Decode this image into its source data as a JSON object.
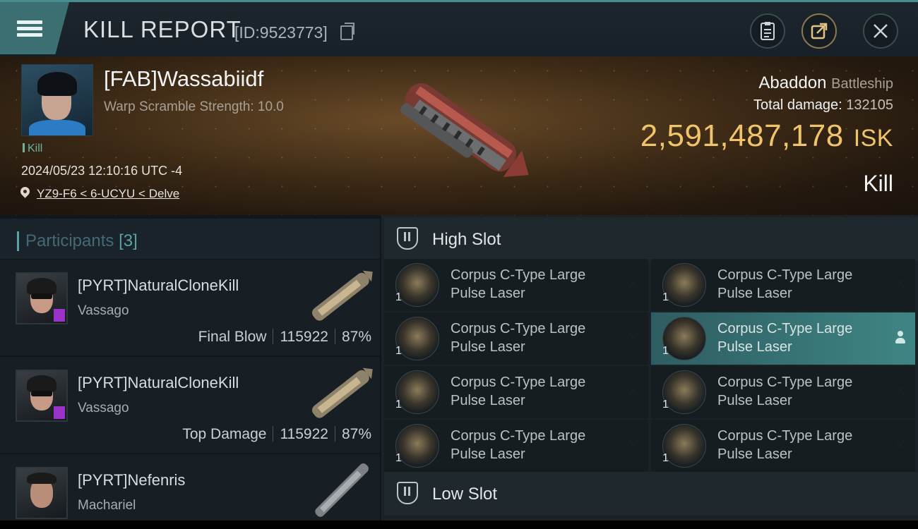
{
  "header": {
    "title": "KILL REPORT",
    "report_id": "[ID:9523773]"
  },
  "victim": {
    "name": "[FAB]Wassabiidf",
    "subtitle": "Warp Scramble Strength: 10.0",
    "kill_tag": "Kill",
    "datetime": "2024/05/23 12:10:16 UTC -4",
    "location": "YZ9-F6 < 6-UCYU < Delve",
    "ship_name": "Abaddon",
    "ship_class": "Battleship",
    "total_damage_label": "Total damage:",
    "total_damage_value": "132105",
    "isk_value": "2,591,487,178",
    "isk_unit": "ISK",
    "result": "Kill"
  },
  "participants": {
    "title": "Participants",
    "count": "[3]",
    "rows": [
      {
        "name": "[PYRT]NaturalCloneKill",
        "ship": "Vassago",
        "role": "Final Blow",
        "damage": "115922",
        "percent": "87%"
      },
      {
        "name": "[PYRT]NaturalCloneKill",
        "ship": "Vassago",
        "role": "Top Damage",
        "damage": "115922",
        "percent": "87%"
      },
      {
        "name": "[PYRT]Nefenris",
        "ship": "Machariel",
        "role": "",
        "damage": "",
        "percent": ""
      }
    ]
  },
  "fitting": {
    "high_slot_label": "High Slot",
    "low_slot_label": "Low Slot",
    "items": [
      {
        "line1": "Corpus C-Type Large",
        "line2": "Pulse Laser",
        "qty": "1"
      },
      {
        "line1": "Corpus C-Type Large",
        "line2": "Pulse Laser",
        "qty": "1"
      },
      {
        "line1": "Corpus C-Type Large",
        "line2": "Pulse Laser",
        "qty": "1"
      },
      {
        "line1": "Corpus C-Type Large",
        "line2": "Pulse Laser",
        "qty": "1"
      },
      {
        "line1": "Corpus C-Type Large",
        "line2": "Pulse Laser",
        "qty": "1"
      },
      {
        "line1": "Corpus C-Type Large",
        "line2": "Pulse Laser",
        "qty": "1"
      },
      {
        "line1": "Corpus C-Type Large",
        "line2": "Pulse Laser",
        "qty": "1"
      },
      {
        "line1": "Corpus C-Type Large",
        "line2": "Pulse Laser",
        "qty": "1"
      }
    ]
  },
  "icons": {
    "menu": "hamburger-menu-icon",
    "copy": "copy-icon",
    "clipboard": "clipboard-icon",
    "share": "share-icon",
    "close": "close-icon",
    "location": "location-pin-icon",
    "slot": "slot-icon",
    "remove": "close-x-icon",
    "pilot": "pilot-icon"
  },
  "colors": {
    "accent": "#5aa2a6",
    "isk": "#f0c46a",
    "selected": "#3f8585",
    "corp_badge": "#9b33c9"
  }
}
